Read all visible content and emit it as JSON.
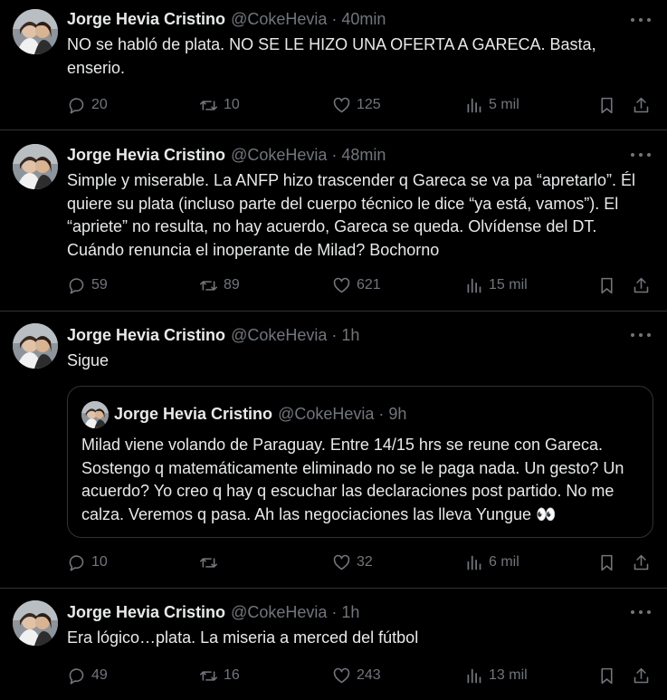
{
  "icons": {
    "reply": "reply-icon",
    "retweet": "retweet-icon",
    "like": "heart-icon",
    "views": "views-chart-icon",
    "bookmark": "bookmark-icon",
    "share": "share-icon",
    "more": "more-dots-icon"
  },
  "colors": {
    "background": "#000000",
    "text": "#e7e9ea",
    "muted": "#71767b",
    "border": "#2f3336"
  },
  "tweets": [
    {
      "name": "Jorge Hevia Cristino",
      "handle": "@CokeHevia",
      "separator": "·",
      "time": "40min",
      "text": "NO se habló de plata. NO SE LE HIZO UNA OFERTA A GARECA. Basta, enserio.",
      "replies": "20",
      "retweets": "10",
      "likes": "125",
      "views": "5 mil"
    },
    {
      "name": "Jorge Hevia Cristino",
      "handle": "@CokeHevia",
      "separator": "·",
      "time": "48min",
      "text": "Simple y miserable. La ANFP hizo trascender q Gareca se va pa “apretarlo”. Él quiere su plata (incluso parte del cuerpo técnico le dice “ya está, vamos”). El “apriete” no resulta, no hay acuerdo, Gareca se queda. Olvídense del DT. Cuándo renuncia el inoperante de Milad? Bochorno",
      "replies": "59",
      "retweets": "89",
      "likes": "621",
      "views": "15 mil"
    },
    {
      "name": "Jorge Hevia Cristino",
      "handle": "@CokeHevia",
      "separator": "·",
      "time": "1h",
      "text": "Sigue",
      "quote": {
        "name": "Jorge Hevia Cristino",
        "handle": "@CokeHevia",
        "separator": "·",
        "time": "9h",
        "text": "Milad viene volando de Paraguay. Entre 14/15 hrs se reune con Gareca. Sostengo q matemáticamente eliminado no se le paga nada. Un gesto? Un acuerdo? Yo creo q hay q escuchar las declaraciones post partido. No me calza. Veremos q pasa. Ah las negociaciones las lleva Yungue 👀"
      },
      "replies": "10",
      "retweets": "",
      "likes": "32",
      "views": "6 mil"
    },
    {
      "name": "Jorge Hevia Cristino",
      "handle": "@CokeHevia",
      "separator": "·",
      "time": "1h",
      "text": "Era lógico…plata. La miseria a merced del fútbol",
      "replies": "49",
      "retweets": "16",
      "likes": "243",
      "views": "13 mil"
    }
  ]
}
